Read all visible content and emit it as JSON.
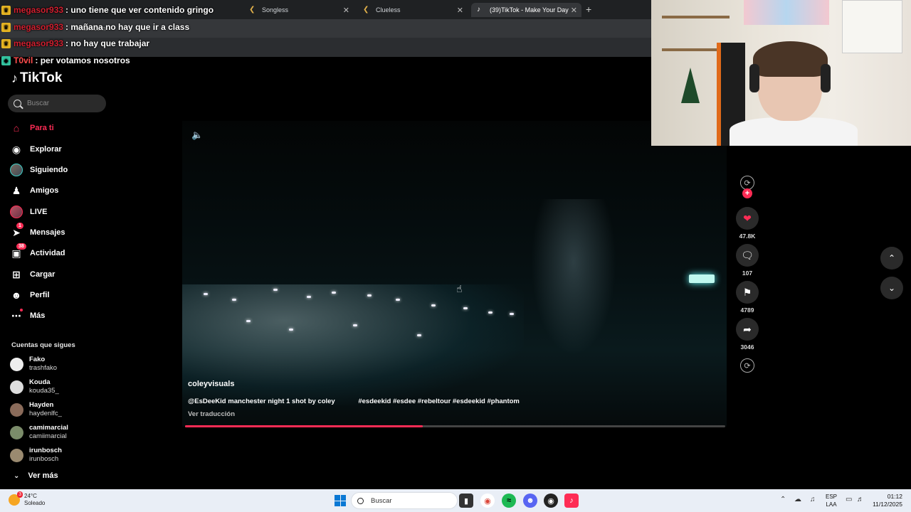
{
  "browser": {
    "tabs": [
      {
        "label": "(39)TikTok - Make Your Day",
        "icon": "tiktok-icon"
      },
      {
        "label": "Songless",
        "icon": "chevron-icon"
      },
      {
        "label": "Clueless",
        "icon": "chevron-icon"
      }
    ],
    "url": "tiktok.com"
  },
  "chat": [
    {
      "user": "megasor933",
      "message": ": uno tiene que ver contenido gringo"
    },
    {
      "user": "megasor933",
      "message": ": mañana no hay que ir a class"
    },
    {
      "user": "megasor933",
      "message": ": no hay que trabajar"
    },
    {
      "user": "T0vil",
      "message": ": per votamos nosotros"
    }
  ],
  "sidebar": {
    "brand": "TikTok",
    "search_placeholder": "Buscar",
    "nav": [
      {
        "label": "Para ti",
        "icon": "home-icon",
        "active": true
      },
      {
        "label": "Explorar",
        "icon": "compass-icon"
      },
      {
        "label": "Siguiendo",
        "icon": "following-avatar-icon"
      },
      {
        "label": "Amigos",
        "icon": "friends-icon"
      },
      {
        "label": "LIVE",
        "icon": "live-icon"
      },
      {
        "label": "Mensajes",
        "icon": "messages-icon",
        "badge": "1"
      },
      {
        "label": "Actividad",
        "icon": "activity-icon",
        "badge": "38"
      },
      {
        "label": "Cargar",
        "icon": "upload-icon"
      },
      {
        "label": "Perfil",
        "icon": "profile-icon"
      },
      {
        "label": "Más",
        "icon": "more-icon"
      }
    ],
    "following_title": "Cuentas que sigues",
    "following": [
      {
        "name": "Fako",
        "handle": "trashfako"
      },
      {
        "name": "Kouda",
        "handle": "kouda35_"
      },
      {
        "name": "Hayden",
        "handle": "haydenlfc_"
      },
      {
        "name": "camimarcial",
        "handle": "camiimarcial"
      },
      {
        "name": "irunbosch",
        "handle": "irunbosch"
      }
    ],
    "see_more": "Ver más"
  },
  "video": {
    "author": "coleyvisuals",
    "description": "@EsDeeKid manchester night 1 shot by coley",
    "hashtags": "#esdeekid #esdee #rebeltour #esdeekid #phantom",
    "translate": "Ver traducción",
    "progress": 0.44
  },
  "actions": {
    "likes": "47.8K",
    "comments": "107",
    "saves": "4789",
    "shares": "3046"
  },
  "taskbar": {
    "temp": "24°C",
    "weather": "Soleado",
    "weather_badge": "3",
    "search": "Buscar",
    "lang1": "ESP",
    "lang2": "LAA",
    "time": "01:12",
    "date": "11/12/2025"
  },
  "colors": {
    "accent": "#fe2c55",
    "background": "#000000"
  }
}
